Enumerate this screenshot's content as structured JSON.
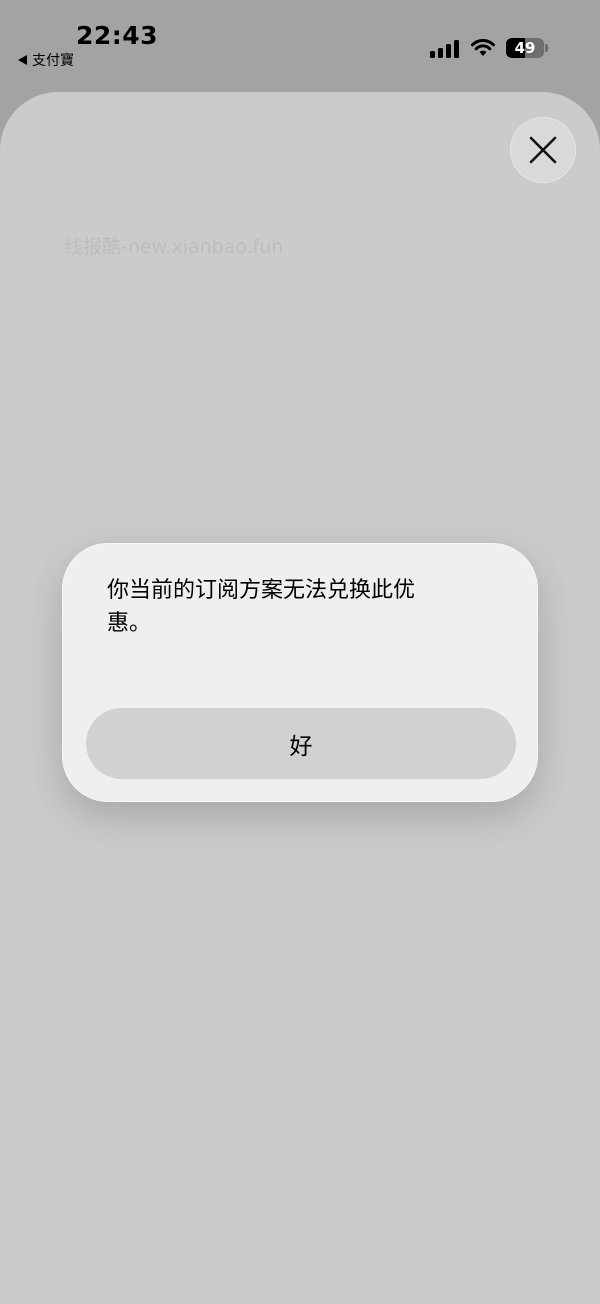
{
  "status_bar": {
    "time": "22:43",
    "back_app": "支付寶",
    "battery_level": "49",
    "battery_fraction": 0.49,
    "signal_bars": 4
  },
  "watermark": "线报酷-new.xianbao.fun",
  "alert": {
    "message": "你当前的订阅方案无法兑换此优惠。",
    "ok_button": "好"
  },
  "colors": {
    "backdrop": "#a3a3a3",
    "sheet": "#cbcbcb",
    "alert_background": "#efefef",
    "alert_button": "#d1d1d1"
  },
  "icons": {
    "back": "back-triangle-icon",
    "signal": "cellular-signal-icon",
    "wifi": "wifi-icon",
    "battery": "battery-icon",
    "close": "close-icon"
  }
}
